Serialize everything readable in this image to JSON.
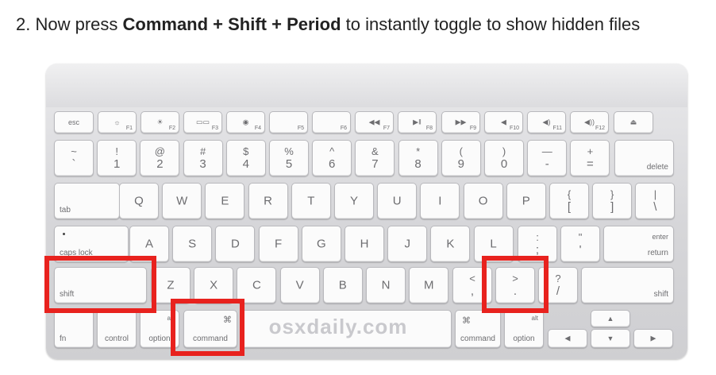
{
  "instruction": {
    "prefix": "2. Now press ",
    "keys": "Command + Shift + Period",
    "suffix": " to instantly toggle to show hidden files"
  },
  "watermark": "osxdaily.com",
  "highlight_color": "#e8221e",
  "keyboard": {
    "function_row": [
      {
        "label": "esc",
        "fn": ""
      },
      {
        "label": "☼",
        "fn": "F1"
      },
      {
        "label": "☀",
        "fn": "F2"
      },
      {
        "label": "▭▭",
        "fn": "F3"
      },
      {
        "label": "◉",
        "fn": "F4"
      },
      {
        "label": "",
        "fn": "F5"
      },
      {
        "label": "",
        "fn": "F6"
      },
      {
        "label": "◀◀",
        "fn": "F7"
      },
      {
        "label": "▶ǁ",
        "fn": "F8"
      },
      {
        "label": "▶▶",
        "fn": "F9"
      },
      {
        "label": "◀",
        "fn": "F10"
      },
      {
        "label": "◀)",
        "fn": "F11"
      },
      {
        "label": "◀))",
        "fn": "F12"
      },
      {
        "label": "⏏",
        "fn": ""
      }
    ],
    "number_row": [
      {
        "top": "~",
        "bot": "`"
      },
      {
        "top": "!",
        "bot": "1"
      },
      {
        "top": "@",
        "bot": "2"
      },
      {
        "top": "#",
        "bot": "3"
      },
      {
        "top": "$",
        "bot": "4"
      },
      {
        "top": "%",
        "bot": "5"
      },
      {
        "top": "^",
        "bot": "6"
      },
      {
        "top": "&",
        "bot": "7"
      },
      {
        "top": "*",
        "bot": "8"
      },
      {
        "top": "(",
        "bot": "9"
      },
      {
        "top": ")",
        "bot": "0"
      },
      {
        "top": "—",
        "bot": "-"
      },
      {
        "top": "+",
        "bot": "="
      }
    ],
    "delete": "delete",
    "tab": "tab",
    "qwerty_row": [
      "Q",
      "W",
      "E",
      "R",
      "T",
      "Y",
      "U",
      "I",
      "O",
      "P"
    ],
    "bracket_keys": [
      {
        "top": "{",
        "bot": "["
      },
      {
        "top": "}",
        "bot": "]"
      },
      {
        "top": "|",
        "bot": "\\"
      }
    ],
    "caps_lock": "caps lock",
    "home_row": [
      "A",
      "S",
      "D",
      "F",
      "G",
      "H",
      "J",
      "K",
      "L"
    ],
    "semicolon": {
      "top": ":",
      "bot": ";"
    },
    "quote": {
      "top": "\"",
      "bot": "'"
    },
    "enter": "enter",
    "return": "return",
    "shift": "shift",
    "bottom_letters": [
      "Z",
      "X",
      "C",
      "V",
      "B",
      "N",
      "M"
    ],
    "comma": {
      "top": "<",
      "bot": ","
    },
    "period": {
      "top": ">",
      "bot": "."
    },
    "slash": {
      "top": "?",
      "bot": "/"
    },
    "right_shift": "shift",
    "fn": "fn",
    "control": "control",
    "alt": "alt",
    "option": "option",
    "command_symbol": "⌘",
    "command": "command",
    "arrows": {
      "up": "▲",
      "left": "◀",
      "down": "▼",
      "right": "▶"
    }
  }
}
